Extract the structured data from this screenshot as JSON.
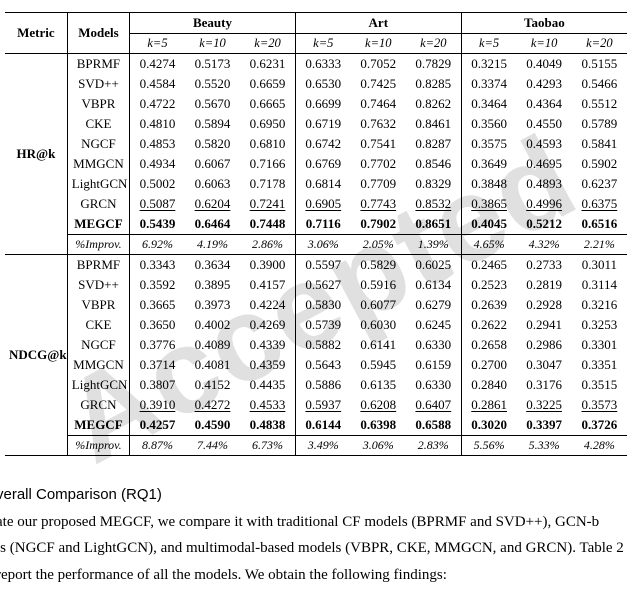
{
  "watermark": "Accepted",
  "table": {
    "head": {
      "metric": "Metric",
      "models": "Models",
      "datasets": [
        "Beauty",
        "Art",
        "Taobao"
      ],
      "k_labels": [
        "k=5",
        "k=10",
        "k=20"
      ]
    },
    "blocks": [
      {
        "metric": "HR@k",
        "rows": [
          {
            "model": "BPRMF",
            "beauty": [
              "0.4274",
              "0.5173",
              "0.6231"
            ],
            "art": [
              "0.6333",
              "0.7052",
              "0.7829"
            ],
            "taobao": [
              "0.3215",
              "0.4049",
              "0.5155"
            ]
          },
          {
            "model": "SVD++",
            "beauty": [
              "0.4584",
              "0.5520",
              "0.6659"
            ],
            "art": [
              "0.6530",
              "0.7425",
              "0.8285"
            ],
            "taobao": [
              "0.3374",
              "0.4293",
              "0.5466"
            ]
          },
          {
            "model": "VBPR",
            "beauty": [
              "0.4722",
              "0.5670",
              "0.6665"
            ],
            "art": [
              "0.6699",
              "0.7464",
              "0.8262"
            ],
            "taobao": [
              "0.3464",
              "0.4364",
              "0.5512"
            ]
          },
          {
            "model": "CKE",
            "beauty": [
              "0.4810",
              "0.5894",
              "0.6950"
            ],
            "art": [
              "0.6719",
              "0.7632",
              "0.8461"
            ],
            "taobao": [
              "0.3560",
              "0.4550",
              "0.5789"
            ]
          },
          {
            "model": "NGCF",
            "beauty": [
              "0.4853",
              "0.5820",
              "0.6810"
            ],
            "art": [
              "0.6742",
              "0.7541",
              "0.8287"
            ],
            "taobao": [
              "0.3575",
              "0.4593",
              "0.5841"
            ]
          },
          {
            "model": "MMGCN",
            "beauty": [
              "0.4934",
              "0.6067",
              "0.7166"
            ],
            "art": [
              "0.6769",
              "0.7702",
              "0.8546"
            ],
            "taobao": [
              "0.3649",
              "0.4695",
              "0.5902"
            ]
          },
          {
            "model": "LightGCN",
            "beauty": [
              "0.5002",
              "0.6063",
              "0.7178"
            ],
            "art": [
              "0.6814",
              "0.7709",
              "0.8329"
            ],
            "taobao": [
              "0.3848",
              "0.4893",
              "0.6237"
            ]
          },
          {
            "model": "GRCN",
            "beauty": [
              "0.5087",
              "0.6204",
              "0.7241"
            ],
            "art": [
              "0.6905",
              "0.7743",
              "0.8532"
            ],
            "taobao": [
              "0.3865",
              "0.4996",
              "0.6375"
            ],
            "second_best": true
          },
          {
            "model": "MEGCF",
            "beauty": [
              "0.5439",
              "0.6464",
              "0.7448"
            ],
            "art": [
              "0.7116",
              "0.7902",
              "0.8651"
            ],
            "taobao": [
              "0.4045",
              "0.5212",
              "0.6516"
            ],
            "best": true
          },
          {
            "model": "%Improv.",
            "beauty": [
              "6.92%",
              "4.19%",
              "2.86%"
            ],
            "art": [
              "3.06%",
              "2.05%",
              "1.39%"
            ],
            "taobao": [
              "4.65%",
              "4.32%",
              "2.21%"
            ],
            "improv": true
          }
        ]
      },
      {
        "metric": "NDCG@k",
        "rows": [
          {
            "model": "BPRMF",
            "beauty": [
              "0.3343",
              "0.3634",
              "0.3900"
            ],
            "art": [
              "0.5597",
              "0.5829",
              "0.6025"
            ],
            "taobao": [
              "0.2465",
              "0.2733",
              "0.3011"
            ]
          },
          {
            "model": "SVD++",
            "beauty": [
              "0.3592",
              "0.3895",
              "0.4157"
            ],
            "art": [
              "0.5627",
              "0.5916",
              "0.6134"
            ],
            "taobao": [
              "0.2523",
              "0.2819",
              "0.3114"
            ]
          },
          {
            "model": "VBPR",
            "beauty": [
              "0.3665",
              "0.3973",
              "0.4224"
            ],
            "art": [
              "0.5830",
              "0.6077",
              "0.6279"
            ],
            "taobao": [
              "0.2639",
              "0.2928",
              "0.3216"
            ]
          },
          {
            "model": "CKE",
            "beauty": [
              "0.3650",
              "0.4002",
              "0.4269"
            ],
            "art": [
              "0.5739",
              "0.6030",
              "0.6245"
            ],
            "taobao": [
              "0.2622",
              "0.2941",
              "0.3253"
            ]
          },
          {
            "model": "NGCF",
            "beauty": [
              "0.3776",
              "0.4089",
              "0.4339"
            ],
            "art": [
              "0.5882",
              "0.6141",
              "0.6330"
            ],
            "taobao": [
              "0.2658",
              "0.2986",
              "0.3301"
            ]
          },
          {
            "model": "MMGCN",
            "beauty": [
              "0.3714",
              "0.4081",
              "0.4359"
            ],
            "art": [
              "0.5643",
              "0.5945",
              "0.6159"
            ],
            "taobao": [
              "0.2700",
              "0.3047",
              "0.3351"
            ]
          },
          {
            "model": "LightGCN",
            "beauty": [
              "0.3807",
              "0.4152",
              "0.4435"
            ],
            "art": [
              "0.5886",
              "0.6135",
              "0.6330"
            ],
            "taobao": [
              "0.2840",
              "0.3176",
              "0.3515"
            ]
          },
          {
            "model": "GRCN",
            "beauty": [
              "0.3910",
              "0.4272",
              "0.4533"
            ],
            "art": [
              "0.5937",
              "0.6208",
              "0.6407"
            ],
            "taobao": [
              "0.2861",
              "0.3225",
              "0.3573"
            ],
            "second_best": true
          },
          {
            "model": "MEGCF",
            "beauty": [
              "0.4257",
              "0.4590",
              "0.4838"
            ],
            "art": [
              "0.6144",
              "0.6398",
              "0.6588"
            ],
            "taobao": [
              "0.3020",
              "0.3397",
              "0.3726"
            ],
            "best": true
          },
          {
            "model": "%Improv.",
            "beauty": [
              "8.87%",
              "7.44%",
              "6.73%"
            ],
            "art": [
              "3.49%",
              "3.06%",
              "2.83%"
            ],
            "taobao": [
              "5.56%",
              "5.33%",
              "4.28%"
            ],
            "improv": true
          }
        ]
      }
    ]
  },
  "body": {
    "heading": "verall Comparison (RQ1)",
    "line1": "ate our proposed MEGCF, we compare it with traditional CF models (BPRMF and SVD++), GCN-b",
    "line2": "ls (NGCF and LightGCN), and multimodal-based models (VBPR, CKE, MMGCN, and GRCN). Table 2",
    "line3": "report the performance of all the models. We obtain the following findings:"
  }
}
